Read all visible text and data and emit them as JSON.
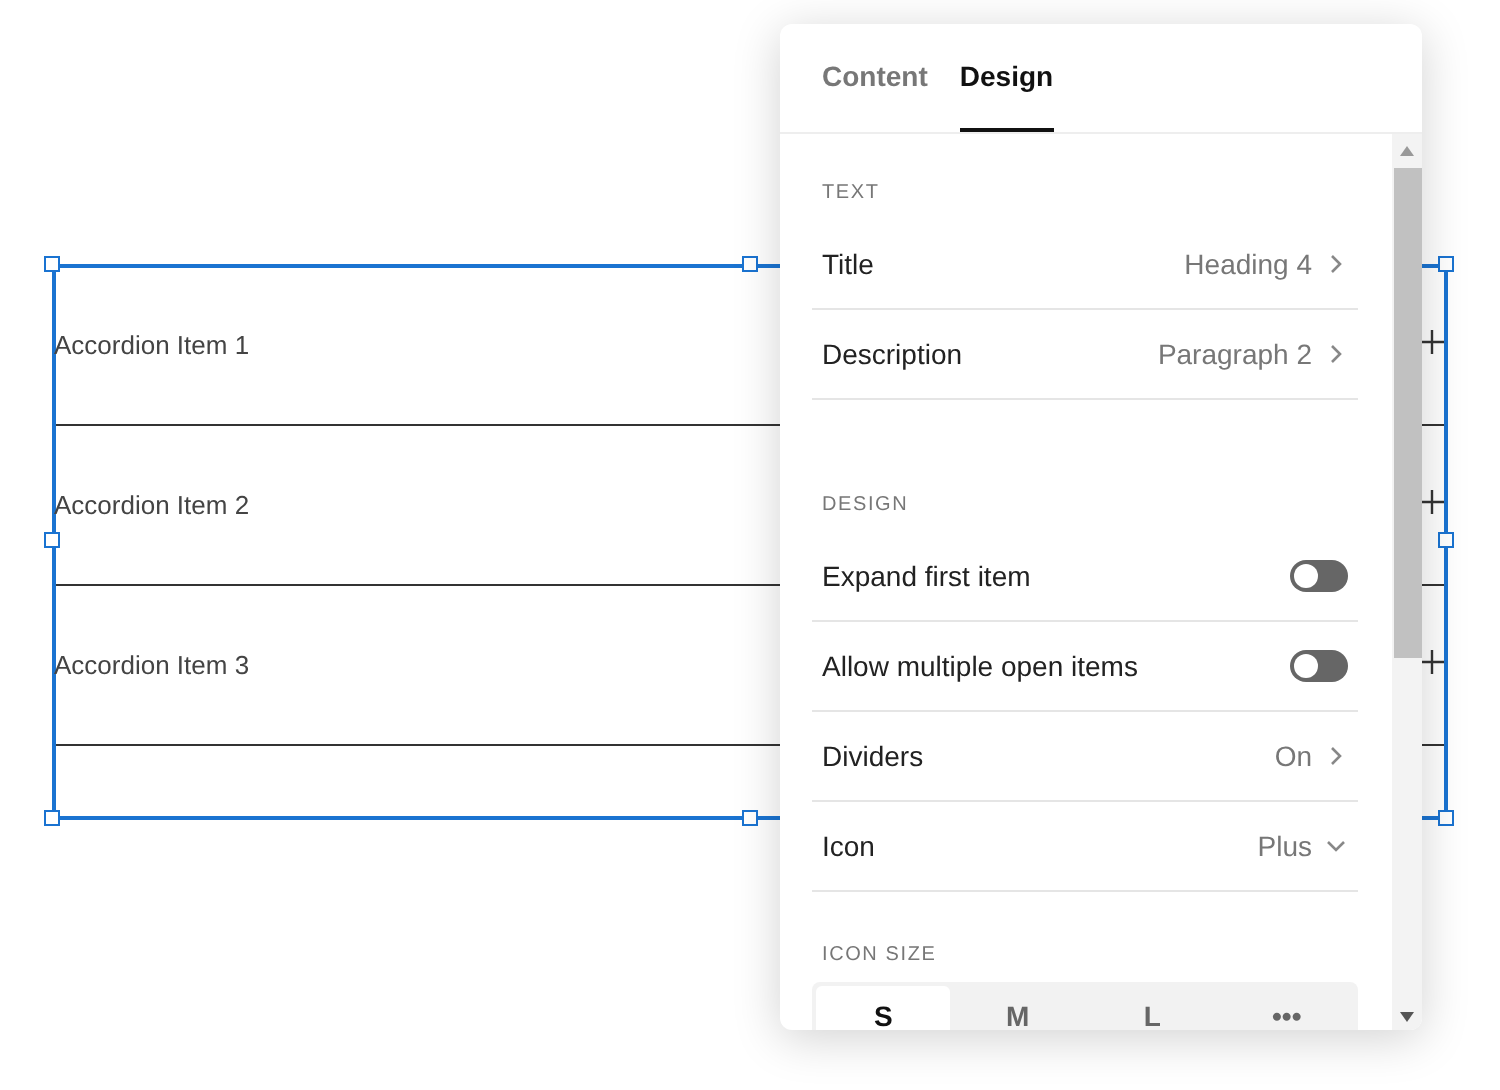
{
  "canvas": {
    "accordion_items": [
      {
        "title": "Accordion Item 1"
      },
      {
        "title": "Accordion Item 2"
      },
      {
        "title": "Accordion Item 3"
      }
    ]
  },
  "panel": {
    "tabs": [
      {
        "label": "Content",
        "selected": false
      },
      {
        "label": "Design",
        "selected": true
      }
    ],
    "sections": [
      {
        "heading": "TEXT",
        "rows": [
          {
            "kind": "nav",
            "label": "Title",
            "value": "Heading 4"
          },
          {
            "kind": "nav",
            "label": "Description",
            "value": "Paragraph 2"
          }
        ]
      },
      {
        "heading": "DESIGN",
        "rows": [
          {
            "kind": "toggle",
            "label": "Expand first item",
            "on": false
          },
          {
            "kind": "toggle",
            "label": "Allow multiple open items",
            "on": false
          },
          {
            "kind": "nav",
            "label": "Dividers",
            "value": "On"
          },
          {
            "kind": "select",
            "label": "Icon",
            "value": "Plus"
          }
        ]
      },
      {
        "heading": "ICON SIZE",
        "rows": [
          {
            "kind": "segmented",
            "options": [
              {
                "label": "S",
                "selected": true
              },
              {
                "label": "M",
                "selected": false
              },
              {
                "label": "L",
                "selected": false
              },
              {
                "label": "•••",
                "selected": false
              }
            ]
          }
        ]
      }
    ]
  }
}
